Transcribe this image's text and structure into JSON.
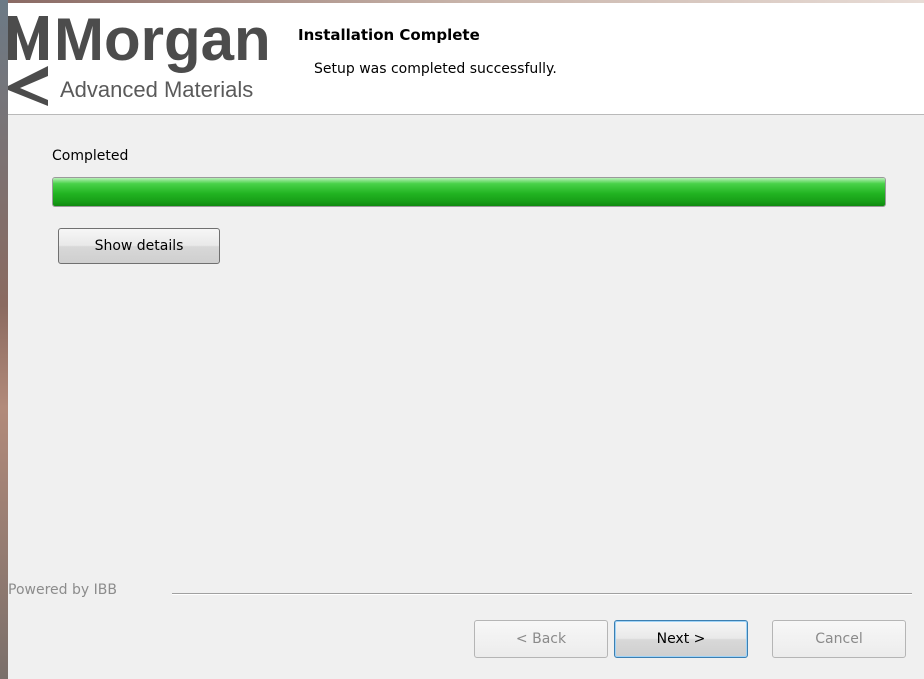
{
  "header": {
    "logo": {
      "wordmark": "Morgan",
      "tagline": "Advanced Materials"
    },
    "title": "Installation Complete",
    "subtitle": "Setup was completed successfully."
  },
  "progress": {
    "label": "Completed",
    "percent": 100,
    "color": "#22b422"
  },
  "details_button": {
    "label": "Show details"
  },
  "footer": {
    "powered_by": "Powered by IBB",
    "buttons": {
      "back": {
        "label": "< Back",
        "enabled": false
      },
      "next": {
        "label": "Next >",
        "enabled": true
      },
      "cancel": {
        "label": "Cancel",
        "enabled": false
      }
    }
  }
}
